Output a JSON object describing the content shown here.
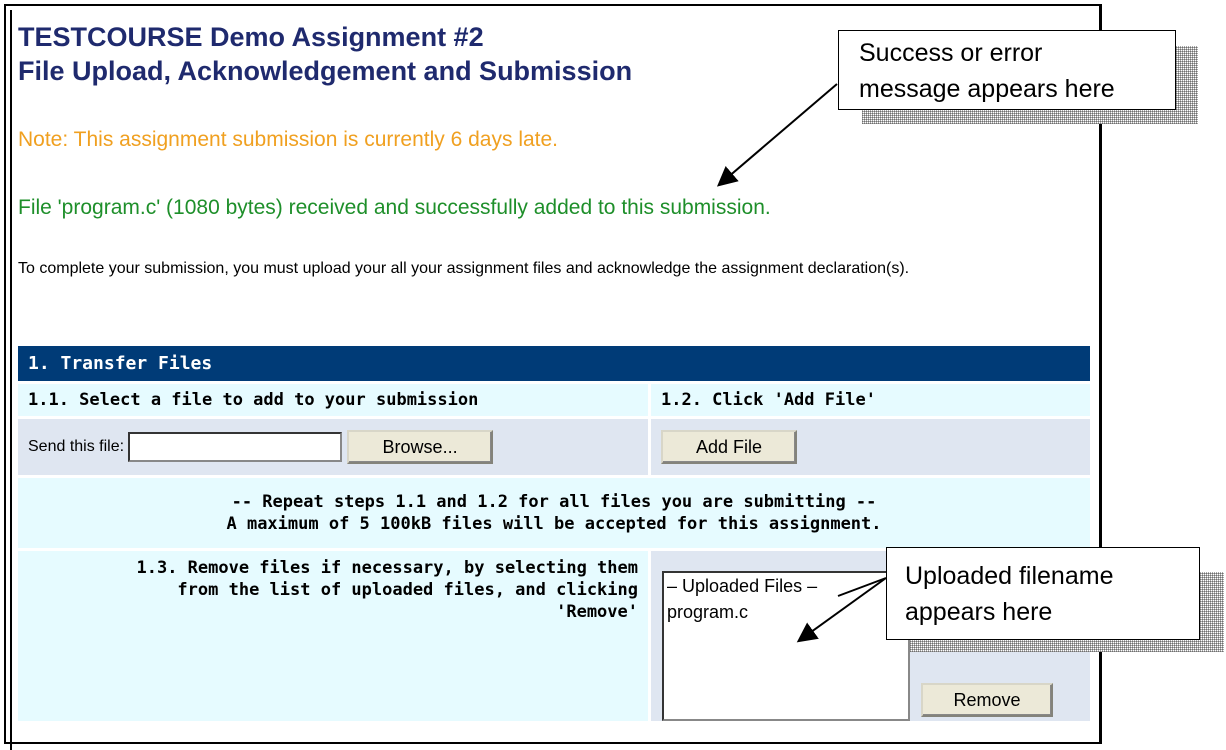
{
  "header": {
    "title_line1": "TESTCOURSE Demo Assignment #2",
    "title_line2": "File Upload, Acknowledgement and Submission"
  },
  "messages": {
    "late_note": "Note: This assignment submission is currently 6 days late.",
    "success": "File 'program.c' (1080 bytes) received and successfully added to this submission.",
    "instructions": "To complete your submission, you must upload your all your assignment files and acknowledge the assignment declaration(s)."
  },
  "transfer": {
    "header": "1. Transfer Files",
    "step_1_1": "1.1. Select a file to add to your submission",
    "step_1_2": "1.2. Click 'Add File'",
    "send_label": "Send this file:",
    "file_value": "",
    "browse_label": "Browse...",
    "add_file_label": "Add File",
    "repeat_line1": "-- Repeat steps 1.1 and 1.2 for all files you are submitting --",
    "repeat_line2": "A maximum of 5 100kB files will be accepted for this assignment.",
    "step_1_3_line1": "1.3. Remove files if necessary, by selecting them",
    "step_1_3_line2": "from the list of uploaded files, and clicking",
    "step_1_3_line3": "'Remove'",
    "uploaded_files_header": "– Uploaded Files –",
    "uploaded_files": [
      "program.c"
    ],
    "remove_label": "Remove"
  },
  "callouts": {
    "message_line1": "Success or error",
    "message_line2": "message appears here",
    "filename_line1": "Uploaded filename",
    "filename_line2": "appears here"
  },
  "colors": {
    "title": "#1f2a6e",
    "late": "#f0a020",
    "success": "#1e8f2a",
    "panel_header": "#003b77"
  }
}
